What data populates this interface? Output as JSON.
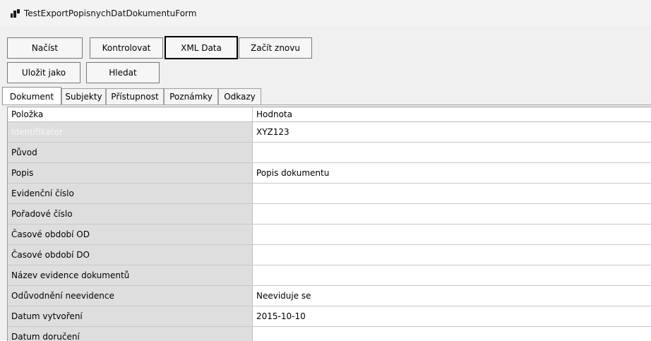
{
  "window": {
    "title": "TestExportPopisnychDatDokumentuForm"
  },
  "toolbar": {
    "load_label": "Načíst",
    "check_label": "Kontrolovat",
    "xml_label": "XML Data",
    "restart_label": "Začít znovu",
    "save_as_label": "Uložit jako",
    "search_label": "Hledat"
  },
  "tabs": [
    {
      "label": "Dokument",
      "active": true
    },
    {
      "label": "Subjekty"
    },
    {
      "label": "Přístupnost"
    },
    {
      "label": "Poznámky"
    },
    {
      "label": "Odkazy"
    }
  ],
  "grid": {
    "columns": [
      "Položka",
      "Hodnota"
    ],
    "rows": [
      {
        "key": "Identifikátor",
        "value": "XYZ123"
      },
      {
        "key": "Původ",
        "value": ""
      },
      {
        "key": "Popis",
        "value": "Popis dokumentu"
      },
      {
        "key": "Evidenční číslo",
        "value": ""
      },
      {
        "key": "Pořadové číslo",
        "value": ""
      },
      {
        "key": "Časové období OD",
        "value": ""
      },
      {
        "key": "Časové období DO",
        "value": ""
      },
      {
        "key": "Název evidence dokumentů",
        "value": ""
      },
      {
        "key": "Odůvodnění neevidence",
        "value": "Neeviduje se"
      },
      {
        "key": "Datum vytvoření",
        "value": "2015-10-10"
      },
      {
        "key": "Datum doručení",
        "value": ""
      }
    ]
  }
}
